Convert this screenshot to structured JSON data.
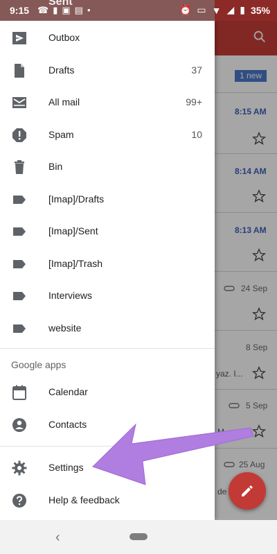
{
  "status_bar": {
    "time": "9:15",
    "battery": "35%",
    "ghost_title": "Sent"
  },
  "drawer": {
    "items": [
      {
        "label": "Outbox",
        "count": "",
        "icon": "outbox-icon"
      },
      {
        "label": "Drafts",
        "count": "37",
        "icon": "drafts-icon"
      },
      {
        "label": "All mail",
        "count": "99+",
        "icon": "all-mail-icon"
      },
      {
        "label": "Spam",
        "count": "10",
        "icon": "spam-icon"
      },
      {
        "label": "Bin",
        "count": "",
        "icon": "bin-icon"
      },
      {
        "label": "[Imap]/Drafts",
        "count": "",
        "icon": "label-icon"
      },
      {
        "label": "[Imap]/Sent",
        "count": "",
        "icon": "label-icon"
      },
      {
        "label": "[Imap]/Trash",
        "count": "",
        "icon": "label-icon"
      },
      {
        "label": "Interviews",
        "count": "",
        "icon": "label-icon"
      },
      {
        "label": "website",
        "count": "",
        "icon": "label-icon"
      }
    ],
    "section_google_apps": "Google apps",
    "apps": [
      {
        "label": "Calendar",
        "icon": "calendar-icon"
      },
      {
        "label": "Contacts",
        "icon": "contacts-icon"
      }
    ],
    "footer": [
      {
        "label": "Settings",
        "icon": "gear-icon"
      },
      {
        "label": "Help & feedback",
        "icon": "help-icon"
      }
    ]
  },
  "background_inbox": {
    "new_badge": "1 new",
    "times": [
      "8:15 AM",
      "8:14 AM",
      "8:13 AM"
    ],
    "dates": [
      "24 Sep",
      "8 Sep",
      "5 Sep",
      "25 Aug"
    ],
    "snippets": [
      "yaz. I...",
      "M",
      "de"
    ]
  },
  "colors": {
    "accent_red": "#c63e39",
    "annotation_arrow": "#b07de0",
    "unread_time_blue": "#3b62b8"
  }
}
